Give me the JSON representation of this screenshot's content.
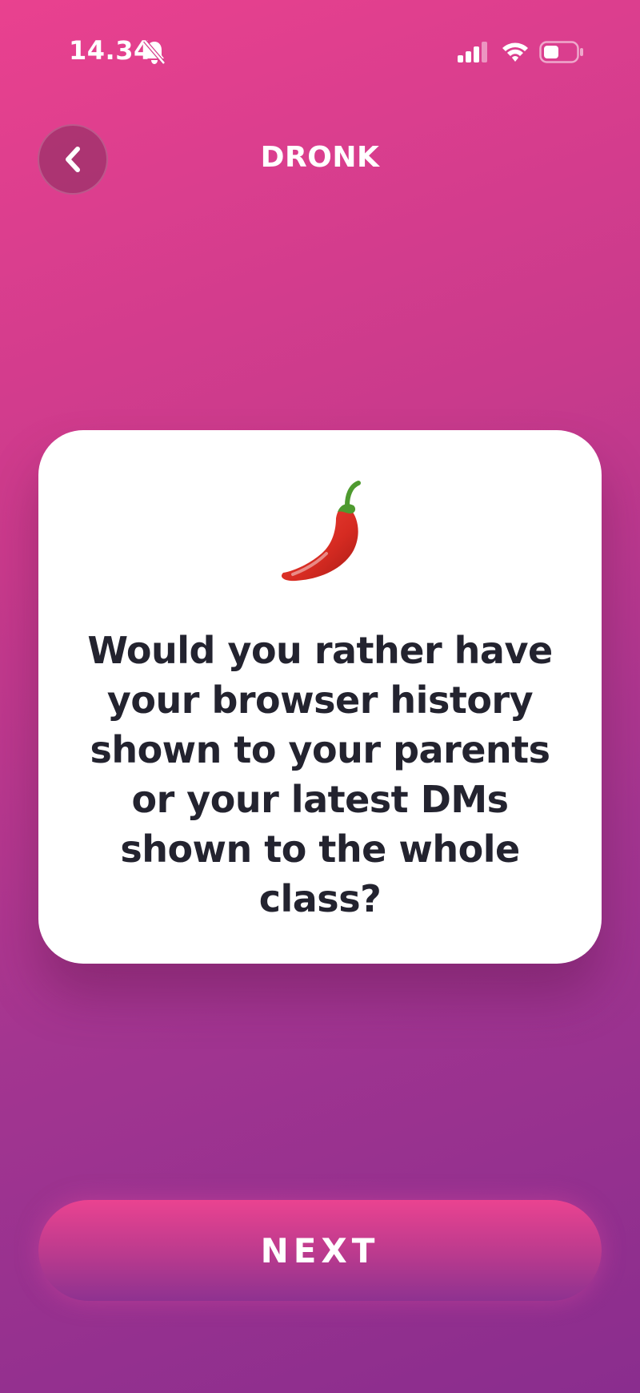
{
  "status_bar": {
    "time": "14.34",
    "icons": [
      "bell-slash-icon",
      "cellular-signal-icon",
      "wifi-icon",
      "battery-icon"
    ]
  },
  "header": {
    "back_icon": "chevron-left-icon",
    "title": "DRONK"
  },
  "card": {
    "emoji_icon": "chili-pepper-icon",
    "question": "Would you rather have your browser history shown to your parents or your latest DMs shown to the whole class?"
  },
  "footer": {
    "next_label": "NEXT"
  },
  "colors": {
    "background_top": "#e9418f",
    "background_bottom": "#8a2d8e",
    "card": "#ffffff",
    "question_text": "#23232f",
    "button_top": "#ea4390",
    "button_bottom": "#8e3290"
  }
}
